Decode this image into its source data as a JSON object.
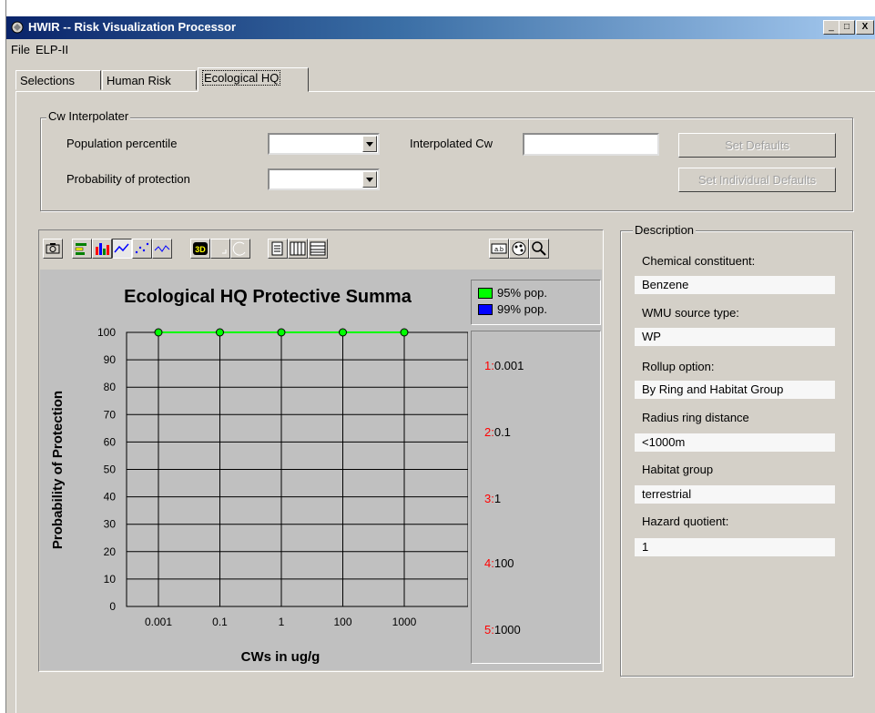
{
  "window": {
    "title": "HWIR -- Risk Visualization Processor",
    "minimize": "_",
    "maximize": "□",
    "close": "X"
  },
  "menu": [
    "File",
    "ELP-II"
  ],
  "tabs": [
    "Selections",
    "Human Risk",
    "Ecological HQ"
  ],
  "active_tab": "Ecological HQ",
  "interpolater": {
    "group_label": "Cw Interpolater",
    "population_percentile_label": "Population percentile",
    "population_percentile_value": "",
    "probability_label": "Probability of protection",
    "probability_value": "",
    "interpolated_label": "Interpolated Cw",
    "interpolated_value": "",
    "set_defaults": "Set Defaults",
    "set_individual_defaults": "Set Individual Defaults"
  },
  "toolbar_icons": [
    "camera-icon",
    "horizontal-bar-chart-icon",
    "bar-chart-icon",
    "line-chart-icon",
    "scatter-chart-icon",
    "area-chart-icon",
    "3d-toggle-icon",
    "rotate-icon",
    "zoom-icon",
    "data-table-icon",
    "vertical-grid-icon",
    "horizontal-grid-icon",
    "labels-icon",
    "palette-icon",
    "magnify-icon"
  ],
  "chart_data": {
    "type": "line",
    "title": "Ecological HQ Protective Summa",
    "xlabel": "CWs in ug/g",
    "ylabel": "Probability of Protection",
    "categories": [
      "0.001",
      "0.1",
      "1",
      "100",
      "1000"
    ],
    "yticks": [
      "0",
      "10",
      "20",
      "30",
      "40",
      "50",
      "60",
      "70",
      "80",
      "90",
      "100"
    ],
    "ylim": [
      0,
      100
    ],
    "grid": true,
    "legend_position": "top-right",
    "series": [
      {
        "name": "95% pop.",
        "color": "#00ff00",
        "values": [
          100,
          100,
          100,
          100,
          100
        ]
      },
      {
        "name": "99% pop.",
        "color": "#0000ff",
        "values": []
      }
    ],
    "data_list": [
      {
        "num": "1:",
        "value": "0.001"
      },
      {
        "num": "2:",
        "value": "0.1"
      },
      {
        "num": "3:",
        "value": "1"
      },
      {
        "num": "4:",
        "value": "100"
      },
      {
        "num": "5:",
        "value": "1000"
      }
    ]
  },
  "description": {
    "group_label": "Description",
    "fields": [
      {
        "label": "Chemical constituent:",
        "value": "Benzene"
      },
      {
        "label": "WMU source type:",
        "value": "WP"
      },
      {
        "label": "Rollup option:",
        "value": "By Ring and Habitat Group"
      },
      {
        "label": "Radius ring distance",
        "value": "<1000m"
      },
      {
        "label": "Habitat group",
        "value": "terrestrial"
      },
      {
        "label": "Hazard quotient:",
        "value": "1"
      }
    ]
  }
}
